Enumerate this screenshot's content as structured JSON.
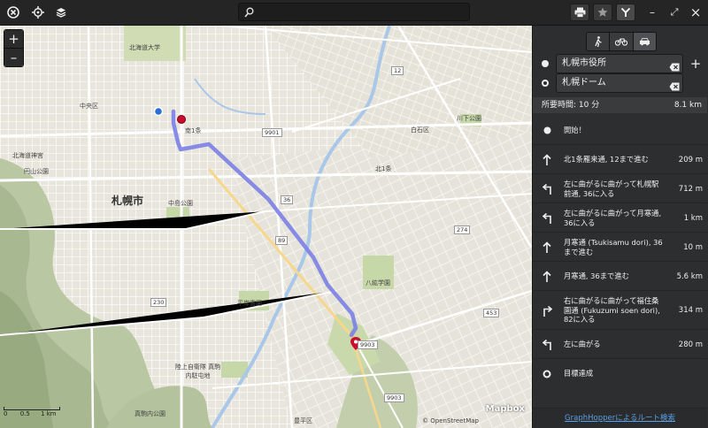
{
  "header": {
    "close_icon": "close-circle-icon",
    "locate_icon": "crosshair-icon",
    "layers_icon": "layers-icon",
    "search": {
      "value": "",
      "placeholder": ""
    },
    "print_icon": "print-icon",
    "favorite_icon": "star-icon",
    "route_icon": "route-icon",
    "minimize_label": "–",
    "maximize_label": "⤢",
    "close_label": "×"
  },
  "map": {
    "zoom_in": "+",
    "zoom_out": "–",
    "labels": [
      {
        "text": "北海道大学"
      },
      {
        "text": "中央区"
      },
      {
        "text": "札幌市",
        "big": true
      },
      {
        "text": "白石区"
      },
      {
        "text": "平岸霊園"
      },
      {
        "text": "八紘学園"
      },
      {
        "text": "豊平区"
      },
      {
        "text": "円山公園"
      },
      {
        "text": "中島公園"
      },
      {
        "text": "北海道神宮"
      },
      {
        "text": "川下公園"
      },
      {
        "text": "陸上自衛隊 真駒内駐屯地"
      },
      {
        "text": "真駒内公園"
      },
      {
        "text": "北1条"
      },
      {
        "text": "南1条"
      }
    ],
    "shields": [
      "9901",
      "9903",
      "9903",
      "89",
      "274",
      "230",
      "12",
      "36",
      "453"
    ],
    "scale": {
      "zero": "0",
      "half": "0.5",
      "one": "1 km"
    },
    "attribution": "© OpenStreetMap",
    "brand": "Mapbox"
  },
  "sidebar": {
    "modes": [
      {
        "name": "walk-icon",
        "selected": false
      },
      {
        "name": "bike-icon",
        "selected": false
      },
      {
        "name": "car-icon",
        "selected": true
      }
    ],
    "origin": "札幌市役所",
    "destination": "札幌ドーム",
    "add_label": "+",
    "summary": {
      "time": "所要時間: 10 分",
      "distance": "8.1 km"
    },
    "steps": [
      {
        "icon": "start-dot-icon",
        "text": "開始！",
        "dist": ""
      },
      {
        "icon": "arrow-up-icon",
        "text": "北1条雁来通, 12まで進む",
        "dist": "209 m"
      },
      {
        "icon": "turn-left-icon",
        "text": "左に曲がるに曲がって札幌駅前通, 36に入る",
        "dist": "712 m"
      },
      {
        "icon": "turn-left-icon",
        "text": "左に曲がるに曲がって月寒通, 36に入る",
        "dist": "1 km"
      },
      {
        "icon": "arrow-up-icon",
        "text": "月寒通 (Tsukisamu dori), 36まで進む",
        "dist": "10 m"
      },
      {
        "icon": "arrow-up-icon",
        "text": "月寒通, 36まで進む",
        "dist": "5.6 km"
      },
      {
        "icon": "turn-right-icon",
        "text": "右に曲がるに曲がって福住桑園通 (Fukuzumi soen dori), 82に入る",
        "dist": "314 m"
      },
      {
        "icon": "turn-left-icon",
        "text": "左に曲がる",
        "dist": "280 m"
      },
      {
        "icon": "finish-ring-icon",
        "text": "目標達成",
        "dist": ""
      }
    ],
    "footer_link": "GraphHopperによるルート検索"
  },
  "colors": {
    "route": "#7b7fe6",
    "accent": "#5aa0e6",
    "origin": "#2a6fd6",
    "destination": "#c8102e"
  }
}
